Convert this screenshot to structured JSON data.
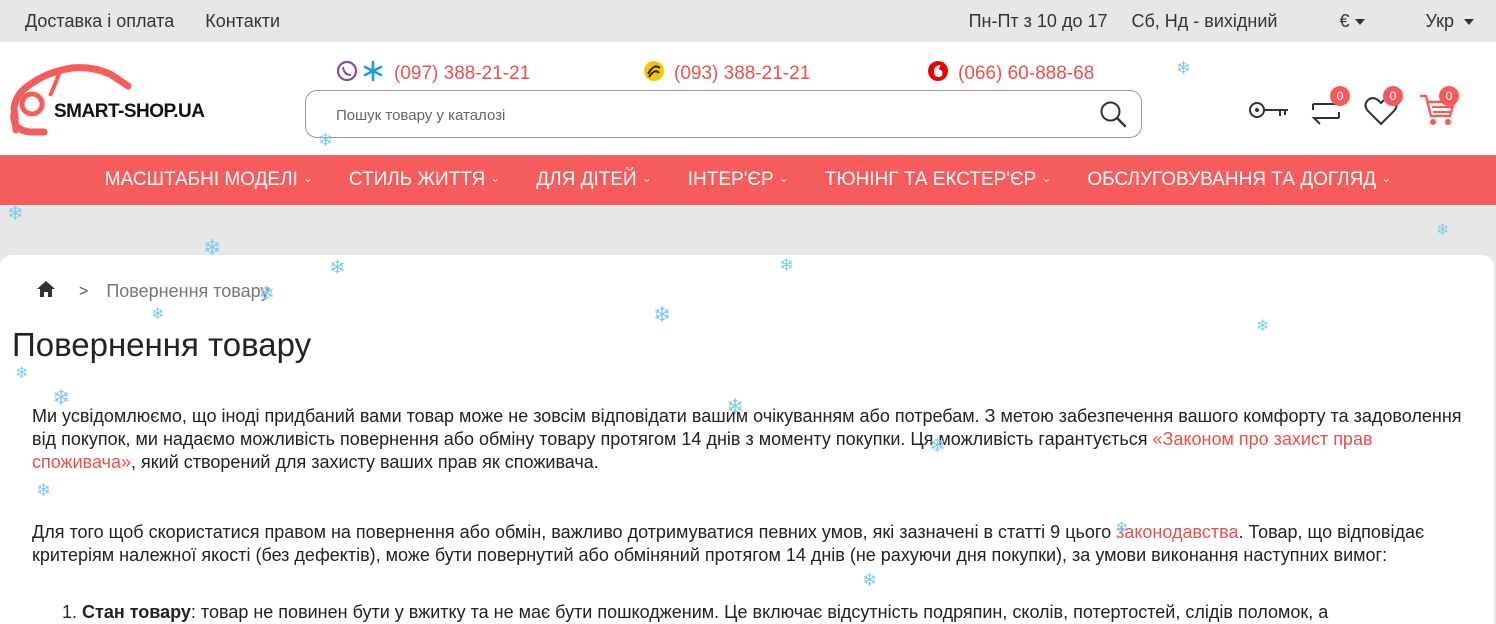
{
  "topbar": {
    "links": [
      "Доставка і оплата",
      "Контакти"
    ],
    "hours_weekdays": "Пн-Пт з 10 до 17",
    "hours_weekend": "Сб, Нд - вихідний",
    "currency": "€",
    "language": "Укр"
  },
  "header": {
    "logo_text": "SMART-SHOP.UA",
    "phones": [
      {
        "number": "(097) 388-21-21",
        "operator_icon": "viber-kyivstar-icon"
      },
      {
        "number": "(093) 388-21-21",
        "operator_icon": "lifecell-icon"
      },
      {
        "number": "(066) 60-888-68",
        "operator_icon": "vodafone-icon"
      }
    ],
    "search_placeholder": "Пошук товару у каталозі",
    "compare_count": "0",
    "wishlist_count": "0",
    "cart_count": "0"
  },
  "nav": {
    "items": [
      "МАСШТАБНІ МОДЕЛІ",
      "СТИЛЬ ЖИТТЯ",
      "ДЛЯ ДІТЕЙ",
      "ІНТЕР'ЄР",
      "ТЮНІНГ ТА ЕКСТЕР'ЄР",
      "ОБСЛУГОВУВАННЯ ТА ДОГЛЯД"
    ]
  },
  "breadcrumb": {
    "current": "Повернення товару"
  },
  "page": {
    "title": "Повернення товару",
    "p1_text": "Ми усвідомлюємо, що іноді придбаний вами товар може не зовсім відповідати вашим очікуванням або потребам. З метою забезпечення вашого комфорту та задоволення від покупок, ми надаємо можливість повернення або обміну товару протягом 14 днів з моменту покупки. Ця можливість гарантується ",
    "p1_link": "«Законом про захист прав споживача»",
    "p1_tail": ", який створений для захисту ваших прав як споживача.",
    "p2_text": "Для того щоб скористатися правом на повернення або обмін, важливо дотримуватися певних умов, які зазначені в статті 9 цього ",
    "p2_link": "законодавства",
    "p2_tail": ". Товар, що відповідає критеріям належної якості (без дефектів), може бути повернутий або обміняний протягом 14 днів (не рахуючи дня покупки), за умови виконання наступних вимог:",
    "list_num": "1.",
    "list_title": "Стан товару",
    "list_text": ": товар не повинен бути у вжитку та не має бути пошкодженим. Це включає відсутність подряпин, сколів, потертостей, слідів поломок, а"
  }
}
